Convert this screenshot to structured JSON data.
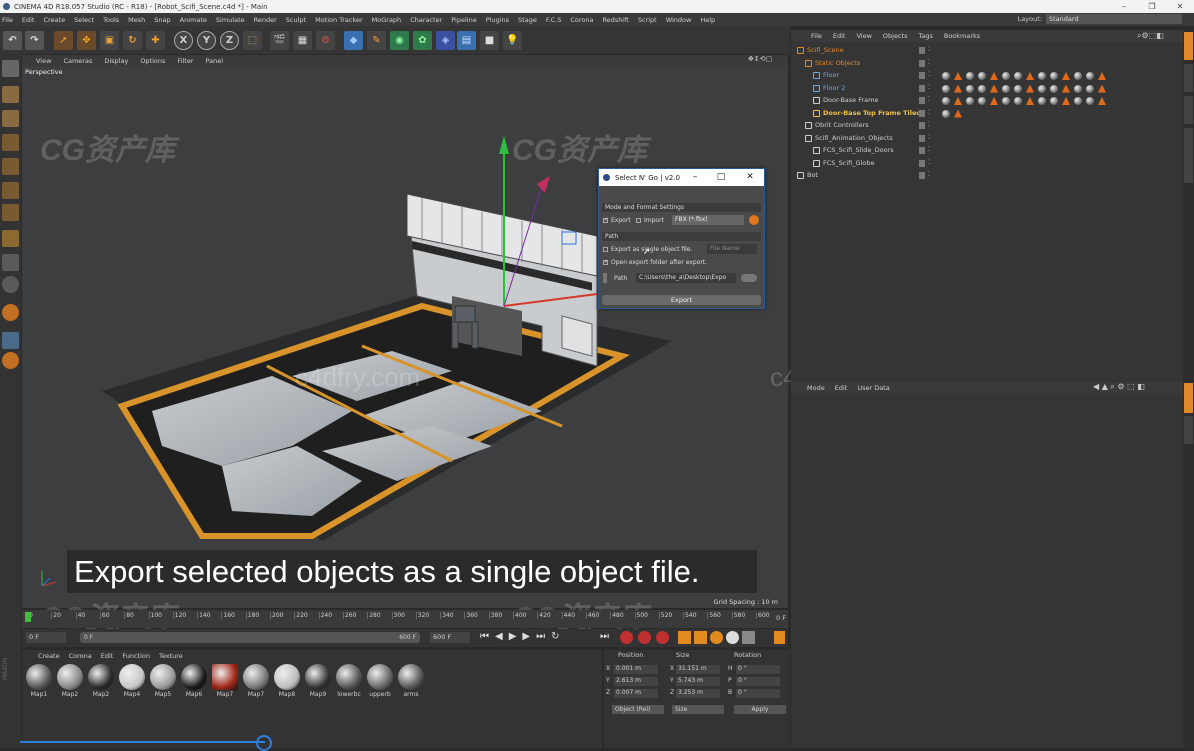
{
  "app": {
    "title": "CINEMA 4D R18.057 Studio (RC - R18) - [Robot_Scifi_Scene.c4d *] - Main",
    "layout_label": "Layout:",
    "layout_value": "Standard"
  },
  "menu": [
    "File",
    "Edit",
    "Create",
    "Select",
    "Tools",
    "Mesh",
    "Snap",
    "Animate",
    "Simulate",
    "Render",
    "Sculpt",
    "Motion Tracker",
    "MoGraph",
    "Character",
    "Pipeline",
    "Plugins",
    "Stage",
    "F.C.S",
    "Corona",
    "Redshift",
    "Script",
    "Window",
    "Help"
  ],
  "viewport": {
    "menu": [
      "View",
      "Cameras",
      "Display",
      "Options",
      "Filter",
      "Panel"
    ],
    "label": "Perspective",
    "grid_spacing": "Grid Spacing : 10 m"
  },
  "subtitle": "Export selected objects as a single object file.",
  "watermark": {
    "brand": "CG资产库",
    "site": "c4dfry.com"
  },
  "timeline": {
    "ticks": [
      "0",
      "20",
      "40",
      "60",
      "80",
      "100",
      "120",
      "140",
      "160",
      "180",
      "200",
      "220",
      "240",
      "260",
      "280",
      "300",
      "320",
      "340",
      "360",
      "380",
      "400",
      "420",
      "440",
      "460",
      "480",
      "500",
      "520",
      "540",
      "560",
      "580",
      "600"
    ],
    "current_frame": "0 F",
    "start": "0 F",
    "end_field": "600 F",
    "max": "600 F",
    "frame_marker": "0 F"
  },
  "materials": {
    "menu": [
      "Create",
      "Corona",
      "Edit",
      "Function",
      "Texture"
    ],
    "items": [
      "Map1",
      "Map2",
      "Map2",
      "Map4",
      "Map5",
      "Map6",
      "Map7",
      "Map7",
      "Map8",
      "Map9",
      "lowerbc",
      "upperb",
      "arms"
    ]
  },
  "coords": {
    "headers": [
      "Position",
      "Size",
      "Rotation"
    ],
    "rows": [
      {
        "axis": "X",
        "pos": "0.001 m",
        "size_axis": "X",
        "size": "31.151 m",
        "rot_axis": "H",
        "rot": "0 °"
      },
      {
        "axis": "Y",
        "pos": "2.613 m",
        "size_axis": "Y",
        "size": "5.743 m",
        "rot_axis": "P",
        "rot": "0 °"
      },
      {
        "axis": "Z",
        "pos": "0.007 m",
        "size_axis": "Z",
        "size": "3.253 m",
        "rot_axis": "B",
        "rot": "0 °"
      }
    ],
    "mode1": "Object (Rel)",
    "mode2": "Size",
    "apply": "Apply"
  },
  "objects": {
    "menu": [
      "File",
      "Edit",
      "View",
      "Objects",
      "Tags",
      "Bookmarks"
    ],
    "rows": [
      {
        "name": "Scifi_Scene",
        "indent": 0,
        "color": "#e0892a"
      },
      {
        "name": "Static Objects",
        "indent": 1,
        "color": "#e0892a"
      },
      {
        "name": "Floor",
        "indent": 2,
        "color": "#6fa8e6"
      },
      {
        "name": "Floor 2",
        "indent": 2,
        "color": "#6fa8e6"
      },
      {
        "name": "Door-Base Frame",
        "indent": 2,
        "color": "#cfcfcf"
      },
      {
        "name": "Door-Base Top Frame Tiled",
        "indent": 2,
        "color": "#f0c040"
      },
      {
        "name": "Obrit Controllers",
        "indent": 1,
        "color": "#cfcfcf"
      },
      {
        "name": "Scifi_Animation_Objects",
        "indent": 1,
        "color": "#cfcfcf"
      },
      {
        "name": "FCS_Scifi_Slide_Doors",
        "indent": 2,
        "color": "#cfcfcf"
      },
      {
        "name": "FCS_Scifi_Globe",
        "indent": 2,
        "color": "#cfcfcf"
      },
      {
        "name": "Bot",
        "indent": 0,
        "color": "#cfcfcf"
      }
    ]
  },
  "attributes": {
    "menu": [
      "Mode",
      "Edit",
      "User Data"
    ]
  },
  "dialog": {
    "title": "Select N' Go | v2.0",
    "section1": "Mode and Format Settings",
    "export_label": "Export",
    "import_label": "Import",
    "format": "FBX (*.fbx)",
    "section2": "Path",
    "single_file_label": "Export as single object file.",
    "file_name_placeholder": "File Name",
    "open_folder_label": "Open export folder after export.",
    "path_label": "Path",
    "path_value": "C:\\Users\\the_a\\Desktop\\Expo",
    "export_button": "Export"
  }
}
